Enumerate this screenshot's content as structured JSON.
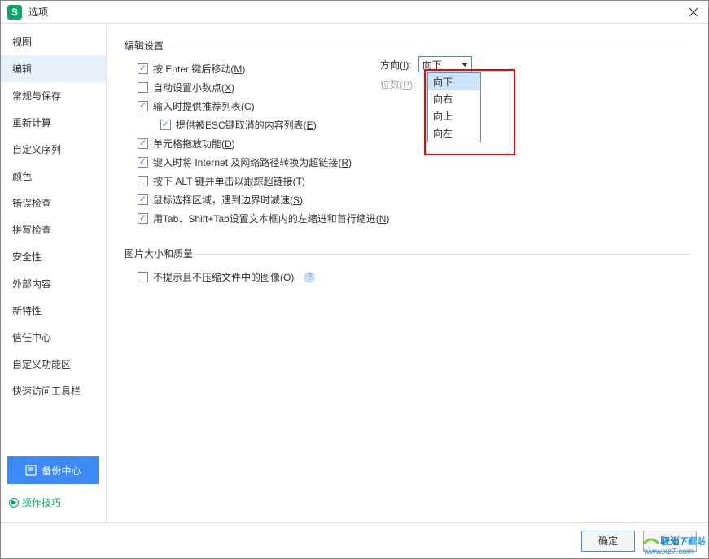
{
  "window": {
    "title": "选项"
  },
  "sidebar": {
    "items": [
      {
        "label": "视图"
      },
      {
        "label": "编辑"
      },
      {
        "label": "常规与保存"
      },
      {
        "label": "重新计算"
      },
      {
        "label": "自定义序列"
      },
      {
        "label": "颜色"
      },
      {
        "label": "错误检查"
      },
      {
        "label": "拼写检查"
      },
      {
        "label": "安全性"
      },
      {
        "label": "外部内容"
      },
      {
        "label": "新特性"
      },
      {
        "label": "信任中心"
      },
      {
        "label": "自定义功能区"
      },
      {
        "label": "快速访问工具栏"
      }
    ],
    "active_index": 1,
    "backup_center": "备份中心",
    "tips": "操作技巧"
  },
  "edit": {
    "section_title": "编辑设置",
    "enter_move": {
      "label_pre": "按 Enter 键后移动(",
      "key": "M",
      "label_post": ")",
      "checked": true
    },
    "direction": {
      "label_pre": "方向(",
      "key": "I",
      "label_post": "):",
      "value": "向下",
      "options": [
        "向下",
        "向右",
        "向上",
        "向左"
      ]
    },
    "auto_decimal": {
      "label_pre": "自动设置小数点(",
      "key": "X",
      "label_post": ")",
      "checked": false
    },
    "digits": {
      "label_pre": "位数(",
      "key": "P",
      "label_post": "):"
    },
    "suggest_list": {
      "label_pre": "输入时提供推荐列表(",
      "key": "C",
      "label_post": ")",
      "checked": true
    },
    "esc_list": {
      "label_pre": "提供被ESC键取消的内容列表(",
      "key": "E",
      "label_post": ")",
      "checked": true
    },
    "drag_zoom": {
      "label_pre": "单元格拖放功能(",
      "key": "D",
      "label_post": ")",
      "checked": true
    },
    "hyperlink": {
      "label_pre": "键入时将 Internet 及网络路径转换为超链接(",
      "key": "R",
      "label_post": ")",
      "checked": true
    },
    "alt_click": {
      "label_pre": "按下 ALT 键并单击以跟踪超链接(",
      "key": "T",
      "label_post": ")",
      "checked": false
    },
    "mouse_select": {
      "label_pre": "鼠标选择区域，遇到边界时减速(",
      "key": "S",
      "label_post": ")",
      "checked": true
    },
    "tab_indent": {
      "label_pre": "用Tab、Shift+Tab设置文本框内的左缩进和首行缩进(",
      "key": "N",
      "label_post": ")",
      "checked": true
    }
  },
  "image": {
    "section_title": "图片大小和质量",
    "no_compress": {
      "label_pre": "不提示且不压缩文件中的图像(",
      "key": "O",
      "label_post": ")",
      "checked": false
    }
  },
  "footer": {
    "ok": "确定",
    "cancel": "取消"
  },
  "watermark": {
    "brand": "极光下载站",
    "url": "www.xz7.com"
  },
  "app_icon_letter": "S"
}
